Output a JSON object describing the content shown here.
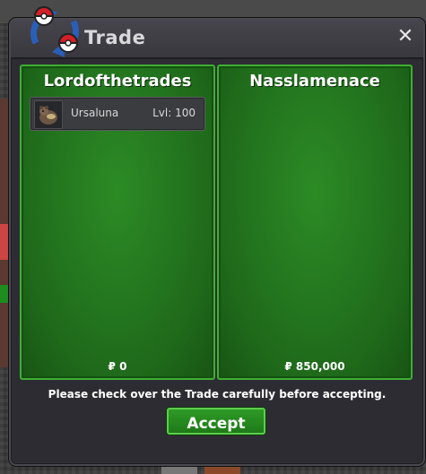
{
  "window": {
    "title": "Trade",
    "close_glyph": "✕"
  },
  "left_panel": {
    "player_name": "Lordofthetrades",
    "items": [
      {
        "name": "Ursaluna",
        "level": "Lvl: 100",
        "icon": "ursaluna-sprite-icon"
      }
    ],
    "money": "₽ 0"
  },
  "right_panel": {
    "player_name": "Nasslamenace",
    "items": [],
    "money": "₽ 850,000"
  },
  "notice": "Please check over the Trade carefully before accepting.",
  "accept_label": "Accept",
  "colors": {
    "panel_green": "#22781d",
    "panel_border": "#3fae32",
    "window_bg": "#2e2c33",
    "pokeball_red": "#d32027",
    "arrow_blue": "#2a5fb8"
  }
}
